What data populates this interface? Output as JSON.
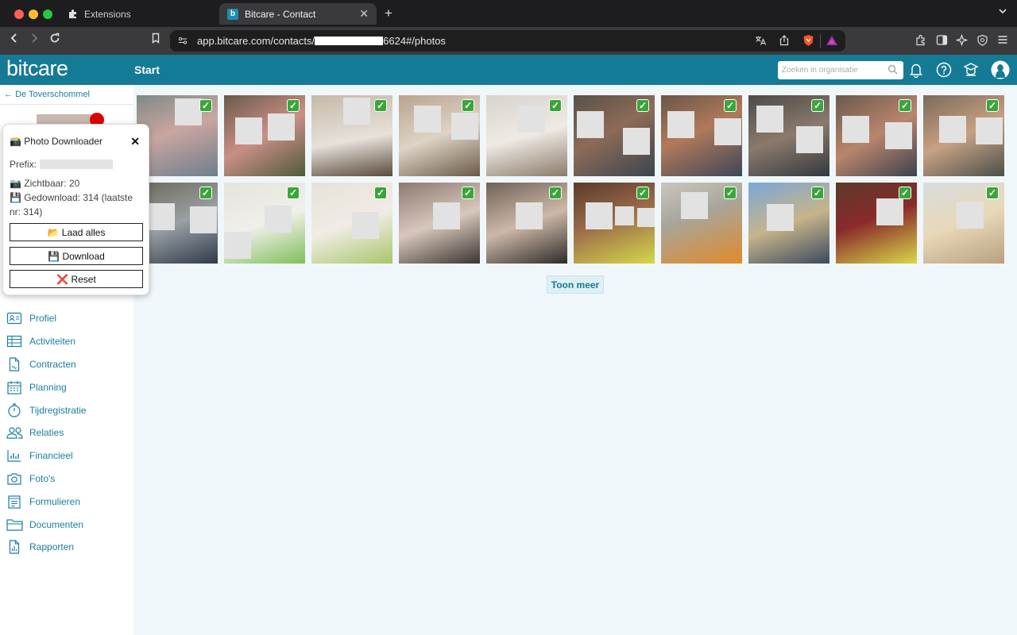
{
  "browser": {
    "tabs": [
      {
        "label": "Extensions",
        "icon": "puzzle-icon"
      },
      {
        "label": "Bitcare - Contact",
        "icon": "bitcare-favicon"
      }
    ],
    "url_prefix": "app.bitcare.com/contacts/",
    "url_suffix": "6624#/photos"
  },
  "header": {
    "logo": "bitcare",
    "nav_title": "Start",
    "search_placeholder": "Zoeken in organisatie"
  },
  "sidebar": {
    "back_label": "De Toverschommel",
    "items": [
      {
        "label": "Profiel",
        "icon": "profile-card-icon"
      },
      {
        "label": "Activiteiten",
        "icon": "table-icon"
      },
      {
        "label": "Contracten",
        "icon": "document-icon"
      },
      {
        "label": "Planning",
        "icon": "calendar-icon"
      },
      {
        "label": "Tijdregistratie",
        "icon": "stopwatch-icon"
      },
      {
        "label": "Relaties",
        "icon": "people-icon"
      },
      {
        "label": "Financieel",
        "icon": "bar-chart-icon"
      },
      {
        "label": "Foto's",
        "icon": "camera-icon"
      },
      {
        "label": "Formulieren",
        "icon": "form-icon"
      },
      {
        "label": "Documenten",
        "icon": "folder-icon"
      },
      {
        "label": "Rapporten",
        "icon": "report-icon"
      }
    ]
  },
  "popup": {
    "title": "📸 Photo Downloader",
    "prefix_label": "Prefix:",
    "visible": "📷 Zichtbaar: 20",
    "downloaded": "💾 Gedownload: 314 (laatste nr: 314)",
    "load_all_label": "📂 Laad alles",
    "download_label": "💾 Download",
    "reset_label": "❌ Reset"
  },
  "photos": {
    "count": 20,
    "checkmark": "✓"
  },
  "show_more_label": "Toon meer",
  "colors": {
    "brand": "#157a95",
    "link": "#1a7ea0",
    "check": "#3aa63a"
  }
}
